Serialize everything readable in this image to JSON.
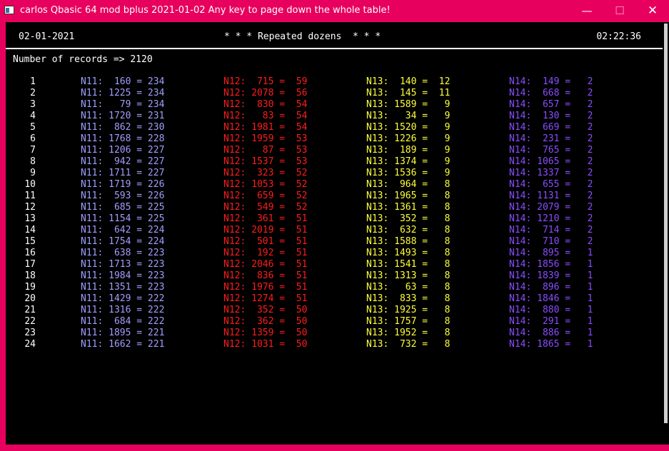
{
  "window": {
    "title": "carlos Qbasic 64 mod bplus 2021-01-02  Any key to page down the whole table!",
    "minimize": "—",
    "maximize": "☐",
    "close": "✕"
  },
  "header": {
    "date": "02-01-2021",
    "title": "* * * Repeated dozens  * * *",
    "time": "02:22:36"
  },
  "records_line": "Number of records => 2120",
  "colors": {
    "n11": "#9f9fff",
    "n12": "#ff1c1c",
    "n13": "#ffff3a",
    "n14": "#8a4dff",
    "titlebar": "#e8005f"
  },
  "rows": [
    {
      "num": "1",
      "n11": "N11:  160 = 234",
      "n12": "N12:  715 =  59",
      "n13": "N13:  140 =  12",
      "n14": "N14:  149 =   2"
    },
    {
      "num": "2",
      "n11": "N11: 1225 = 234",
      "n12": "N12: 2078 =  56",
      "n13": "N13:  145 =  11",
      "n14": "N14:  668 =   2"
    },
    {
      "num": "3",
      "n11": "N11:   79 = 234",
      "n12": "N12:  830 =  54",
      "n13": "N13: 1589 =   9",
      "n14": "N14:  657 =   2"
    },
    {
      "num": "4",
      "n11": "N11: 1720 = 231",
      "n12": "N12:   83 =  54",
      "n13": "N13:   34 =   9",
      "n14": "N14:  130 =   2"
    },
    {
      "num": "5",
      "n11": "N11:  862 = 230",
      "n12": "N12: 1981 =  54",
      "n13": "N13: 1520 =   9",
      "n14": "N14:  669 =   2"
    },
    {
      "num": "6",
      "n11": "N11: 1768 = 228",
      "n12": "N12: 1959 =  53",
      "n13": "N13: 1226 =   9",
      "n14": "N14:  231 =   2"
    },
    {
      "num": "7",
      "n11": "N11: 1206 = 227",
      "n12": "N12:   87 =  53",
      "n13": "N13:  189 =   9",
      "n14": "N14:  765 =   2"
    },
    {
      "num": "8",
      "n11": "N11:  942 = 227",
      "n12": "N12: 1537 =  53",
      "n13": "N13: 1374 =   9",
      "n14": "N14: 1065 =   2"
    },
    {
      "num": "9",
      "n11": "N11: 1711 = 227",
      "n12": "N12:  323 =  52",
      "n13": "N13: 1536 =   9",
      "n14": "N14: 1337 =   2"
    },
    {
      "num": "10",
      "n11": "N11: 1719 = 226",
      "n12": "N12: 1053 =  52",
      "n13": "N13:  964 =   8",
      "n14": "N14:  655 =   2"
    },
    {
      "num": "11",
      "n11": "N11:  593 = 226",
      "n12": "N12:  659 =  52",
      "n13": "N13: 1965 =   8",
      "n14": "N14: 1131 =   2"
    },
    {
      "num": "12",
      "n11": "N11:  685 = 225",
      "n12": "N12:  549 =  52",
      "n13": "N13: 1361 =   8",
      "n14": "N14: 2079 =   2"
    },
    {
      "num": "13",
      "n11": "N11: 1154 = 225",
      "n12": "N12:  361 =  51",
      "n13": "N13:  352 =   8",
      "n14": "N14: 1210 =   2"
    },
    {
      "num": "14",
      "n11": "N11:  642 = 224",
      "n12": "N12: 2019 =  51",
      "n13": "N13:  632 =   8",
      "n14": "N14:  714 =   2"
    },
    {
      "num": "15",
      "n11": "N11: 1754 = 224",
      "n12": "N12:  501 =  51",
      "n13": "N13: 1588 =   8",
      "n14": "N14:  710 =   2"
    },
    {
      "num": "16",
      "n11": "N11:  638 = 223",
      "n12": "N12:  192 =  51",
      "n13": "N13: 1493 =   8",
      "n14": "N14:  895 =   1"
    },
    {
      "num": "17",
      "n11": "N11: 1713 = 223",
      "n12": "N12: 2046 =  51",
      "n13": "N13: 1541 =   8",
      "n14": "N14: 1856 =   1"
    },
    {
      "num": "18",
      "n11": "N11: 1984 = 223",
      "n12": "N12:  836 =  51",
      "n13": "N13: 1313 =   8",
      "n14": "N14: 1839 =   1"
    },
    {
      "num": "19",
      "n11": "N11: 1351 = 223",
      "n12": "N12: 1976 =  51",
      "n13": "N13:   63 =   8",
      "n14": "N14:  896 =   1"
    },
    {
      "num": "20",
      "n11": "N11: 1429 = 222",
      "n12": "N12: 1274 =  51",
      "n13": "N13:  833 =   8",
      "n14": "N14: 1846 =   1"
    },
    {
      "num": "21",
      "n11": "N11: 1316 = 222",
      "n12": "N12:  352 =  50",
      "n13": "N13: 1925 =   8",
      "n14": "N14:  880 =   1"
    },
    {
      "num": "22",
      "n11": "N11:  684 = 222",
      "n12": "N12:  362 =  50",
      "n13": "N13: 1757 =   8",
      "n14": "N14:  291 =   1"
    },
    {
      "num": "23",
      "n11": "N11: 1895 = 221",
      "n12": "N12: 1359 =  50",
      "n13": "N13: 1952 =   8",
      "n14": "N14:  886 =   1"
    },
    {
      "num": "24",
      "n11": "N11: 1662 = 221",
      "n12": "N12: 1031 =  50",
      "n13": "N13:  732 =   8",
      "n14": "N14: 1865 =   1"
    }
  ]
}
